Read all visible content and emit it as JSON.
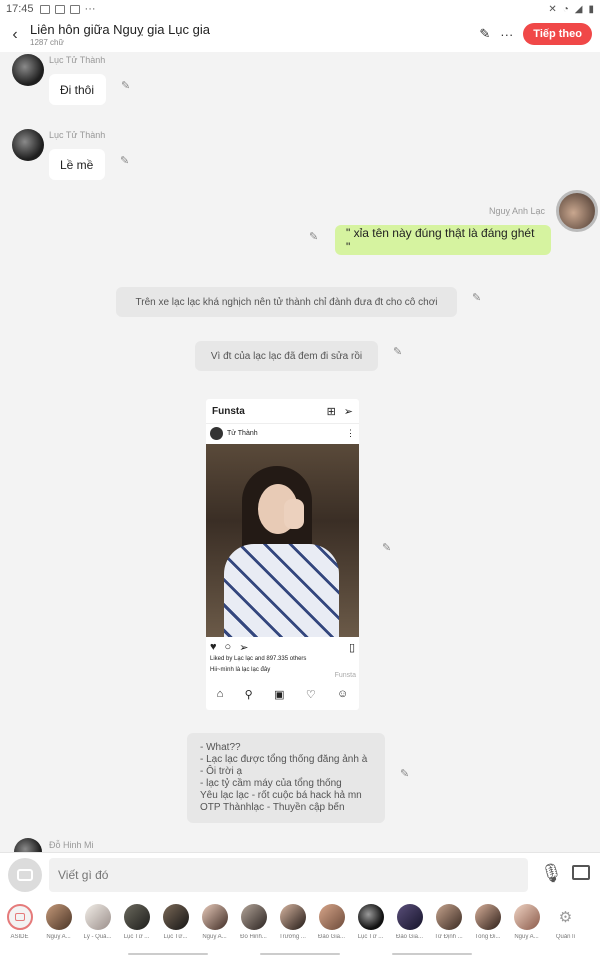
{
  "status": {
    "time": "17:45",
    "dots": "···"
  },
  "header": {
    "title": "Liên hôn giữa Nguỵ gia Lục gia",
    "subtitle": "1287 chữ",
    "next_label": "Tiếp theo"
  },
  "messages": [
    {
      "name": "Lục Tử Thành",
      "text": "Đi thôi"
    },
    {
      "name": "Lục Tử Thành",
      "text": "Lề mề"
    },
    {
      "name": "Nguỵ Anh Lạc",
      "text": "\" xỉa tên này đúng thật là đáng ghét \""
    }
  ],
  "narration": [
    "Trên xe lạc lạc khá nghịch nên tử thành chỉ đành đưa đt cho cô chơi",
    "Vì đt của lạc lạc đã đem đi sửa rồi"
  ],
  "instagram": {
    "app": "Funsta",
    "username": "Tử Thành",
    "liked_by": "Liked by Lạc lạc and 897.335 others",
    "caption": "Hii~mình là lạc lạc đây",
    "watermark": "Funsta"
  },
  "note_lines": [
    "- What??",
    "- Lạc lạc được tổng thống đăng ảnh à",
    "- Ôi trời ạ",
    "- lạc tỷ cầm máy của tổng thống",
    "Yêu lạc lạc - rốt cuộc bá hack hả mn",
    "OTP Thànhlạc - Thuyền cập bến"
  ],
  "partial_name": "Đỗ Hinh Mi",
  "input": {
    "placeholder": "Viết gì đó"
  },
  "characters": [
    "ASIDE",
    "Nguỵ A...",
    "Lý - Quả...",
    "Lục Tử ...",
    "Lục Tử...",
    "Nguỵ A...",
    "Đỗ Hinh...",
    "Trường ...",
    "Đào Gia...",
    "Lục Tử ...",
    "Đào Gia...",
    "Tử Định ...",
    "Tống Đi...",
    "Nguỵ A...",
    "Quản lí"
  ],
  "colors": {
    "accent": "#f04848",
    "green_bubble": "#d6f3a0"
  }
}
